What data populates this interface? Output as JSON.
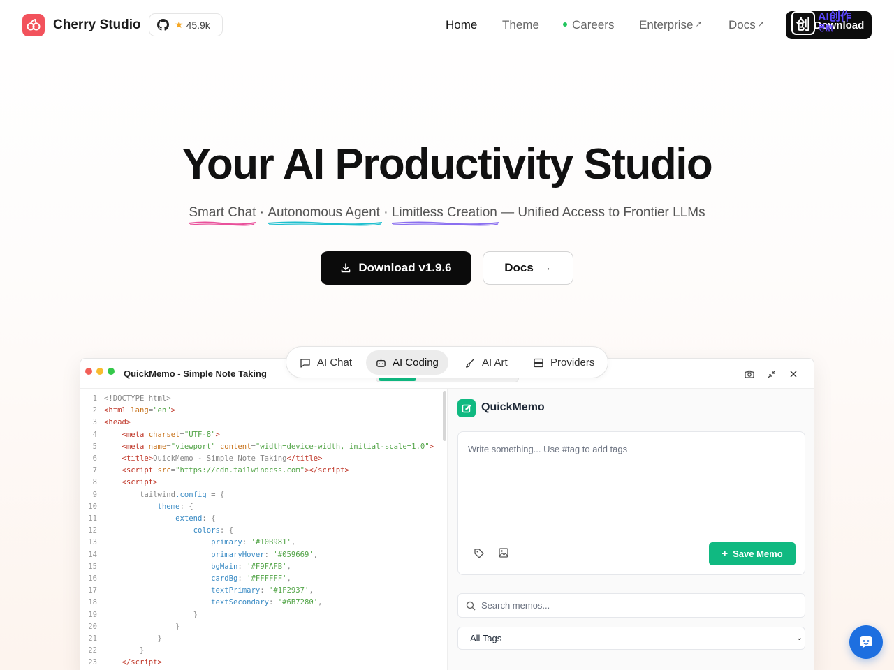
{
  "header": {
    "brand": "Cherry Studio",
    "github_stars": "45.9k",
    "nav": [
      {
        "label": "Home",
        "active": true
      },
      {
        "label": "Theme"
      },
      {
        "label": "Careers",
        "dot_color": "#22c55e"
      },
      {
        "label": "Enterprise",
        "external": true
      },
      {
        "label": "Docs",
        "external": true
      }
    ],
    "download_label": "Download",
    "watermark_glyph": "创",
    "watermark_text": "AI创作",
    "watermark_sub": "导航"
  },
  "hero": {
    "title": "Your AI Productivity Studio",
    "sub_1": "Smart Chat",
    "sep_1": " · ",
    "sub_2": "Autonomous Agent",
    "sep_2": " · ",
    "sub_3": "Limitless Creation",
    "sub_rest": " — Unified Access to Frontier LLMs",
    "cta_primary": "Download v1.9.6",
    "cta_secondary": "Docs",
    "underline_colors": [
      "#e9509b",
      "#1fbfcf",
      "#8b6ff0"
    ]
  },
  "tabs": [
    {
      "label": "AI Chat",
      "icon": "message-square-icon"
    },
    {
      "label": "AI Coding",
      "icon": "bot-icon",
      "active": true
    },
    {
      "label": "AI Art",
      "icon": "brush-icon"
    },
    {
      "label": "Providers",
      "icon": "server-icon"
    }
  ],
  "window": {
    "title": "QuickMemo - Simple Note Taking",
    "traffic_lights": [
      "#f25f58",
      "#f8bc2f",
      "#34c84a"
    ]
  },
  "code_lines": [
    "1",
    "2",
    "3",
    "4",
    "5",
    "6",
    "7",
    "8",
    "9",
    "10",
    "11",
    "12",
    "13",
    "14",
    "15",
    "16",
    "17",
    "18",
    "19",
    "20",
    "21",
    "22",
    "23"
  ],
  "preview": {
    "app_name": "QuickMemo",
    "textarea_placeholder": "Write something... Use #tag to add tags",
    "save_label": "Save Memo",
    "search_placeholder": "Search memos...",
    "tag_filter": "All Tags",
    "accent": "#10b981"
  }
}
